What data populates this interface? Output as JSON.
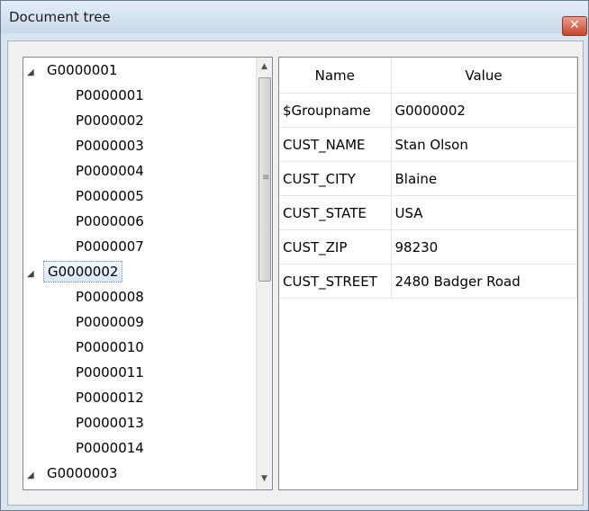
{
  "window": {
    "title": "Document tree",
    "close_glyph": "✕"
  },
  "tree": {
    "expanded_glyph": "◢",
    "groups": [
      {
        "label": "G0000001",
        "children": [
          "P0000001",
          "P0000002",
          "P0000003",
          "P0000004",
          "P0000005",
          "P0000006",
          "P0000007"
        ]
      },
      {
        "label": "G0000002",
        "selected": true,
        "children": [
          "P0000008",
          "P0000009",
          "P0000010",
          "P0000011",
          "P0000012",
          "P0000013",
          "P0000014"
        ]
      },
      {
        "label": "G0000003",
        "children": []
      }
    ],
    "scrollbar": {
      "up_glyph": "▲",
      "down_glyph": "▼",
      "grip_glyph": "≡"
    }
  },
  "grid": {
    "columns": [
      "Name",
      "Value"
    ],
    "rows": [
      [
        "$Groupname",
        "G0000002"
      ],
      [
        "CUST_NAME",
        "Stan Olson"
      ],
      [
        "CUST_CITY",
        "Blaine"
      ],
      [
        "CUST_STATE",
        "USA"
      ],
      [
        "CUST_ZIP",
        "98230"
      ],
      [
        "CUST_STREET",
        "2480 Badger Road"
      ]
    ]
  }
}
